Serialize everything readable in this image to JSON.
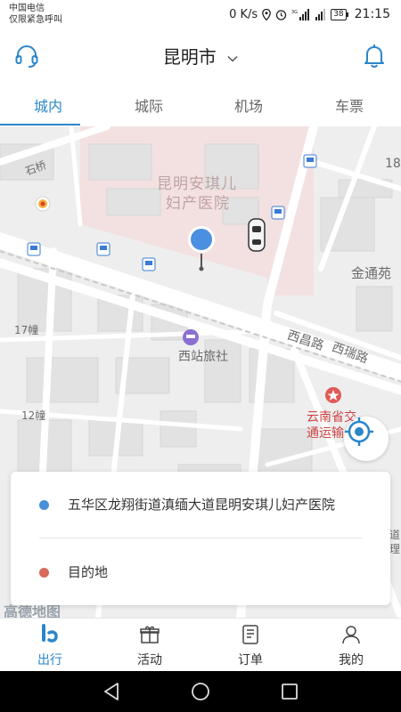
{
  "status_bar": {
    "carrier_line1": "中国电信",
    "carrier_line2": "仅限紧急呼叫",
    "net_speed": "0 K/s",
    "battery": "38",
    "time": "21:15"
  },
  "header": {
    "city": "昆明市",
    "support_icon": "headset-icon",
    "bell_icon": "bell-icon"
  },
  "tabs": [
    {
      "label": "城内",
      "active": true
    },
    {
      "label": "城际",
      "active": false
    },
    {
      "label": "机场",
      "active": false
    },
    {
      "label": "车票",
      "active": false
    }
  ],
  "map": {
    "labels": {
      "hospital_line1": "昆明安琪儿",
      "hospital_line2": "妇产医院",
      "hotel": "西站旅社",
      "road_xichang": "西昌路",
      "road_xirui": "西瑞路",
      "shiqiao": "石桥",
      "jintongyuan": "金通苑",
      "yunnan_line1": "云南省交",
      "yunnan_line2": "通运输",
      "bldg17": "17幢",
      "bldg12": "12幢",
      "n18": "18",
      "road_right": "道",
      "li": "理",
      "gao": "高德地图"
    },
    "accent": "#2b86c9",
    "pin_color": "#4a8fe0"
  },
  "card": {
    "start_address": "五华区龙翔街道滇缅大道昆明安琪儿妇产医院",
    "destination_placeholder": "目的地",
    "start_dot_color": "#4a90d9",
    "dest_dot_color": "#d9695a"
  },
  "bottom_nav": [
    {
      "label": "出行",
      "icon": "travel-icon",
      "active": true
    },
    {
      "label": "活动",
      "icon": "gift-icon",
      "active": false
    },
    {
      "label": "订单",
      "icon": "order-icon",
      "active": false
    },
    {
      "label": "我的",
      "icon": "user-icon",
      "active": false
    }
  ]
}
